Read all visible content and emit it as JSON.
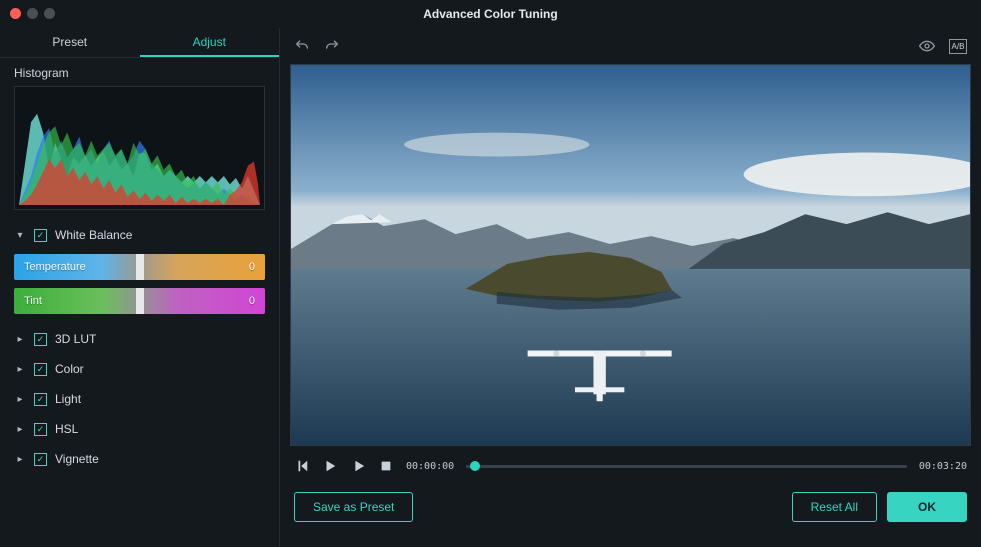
{
  "window": {
    "title": "Advanced Color Tuning"
  },
  "tabs": {
    "preset": "Preset",
    "adjust": "Adjust",
    "active": "adjust"
  },
  "histogram": {
    "label": "Histogram"
  },
  "whiteBalance": {
    "label": "White Balance",
    "temperature": {
      "label": "Temperature",
      "value": "0"
    },
    "tint": {
      "label": "Tint",
      "value": "0"
    }
  },
  "sections": {
    "lut": "3D LUT",
    "color": "Color",
    "light": "Light",
    "hsl": "HSL",
    "vignette": "Vignette"
  },
  "toolbar": {
    "compare_label": "A/B"
  },
  "transport": {
    "current": "00:00:00",
    "duration": "00:03:20",
    "progress_percent": 2
  },
  "footer": {
    "save_preset": "Save as Preset",
    "reset_all": "Reset All",
    "ok": "OK"
  }
}
